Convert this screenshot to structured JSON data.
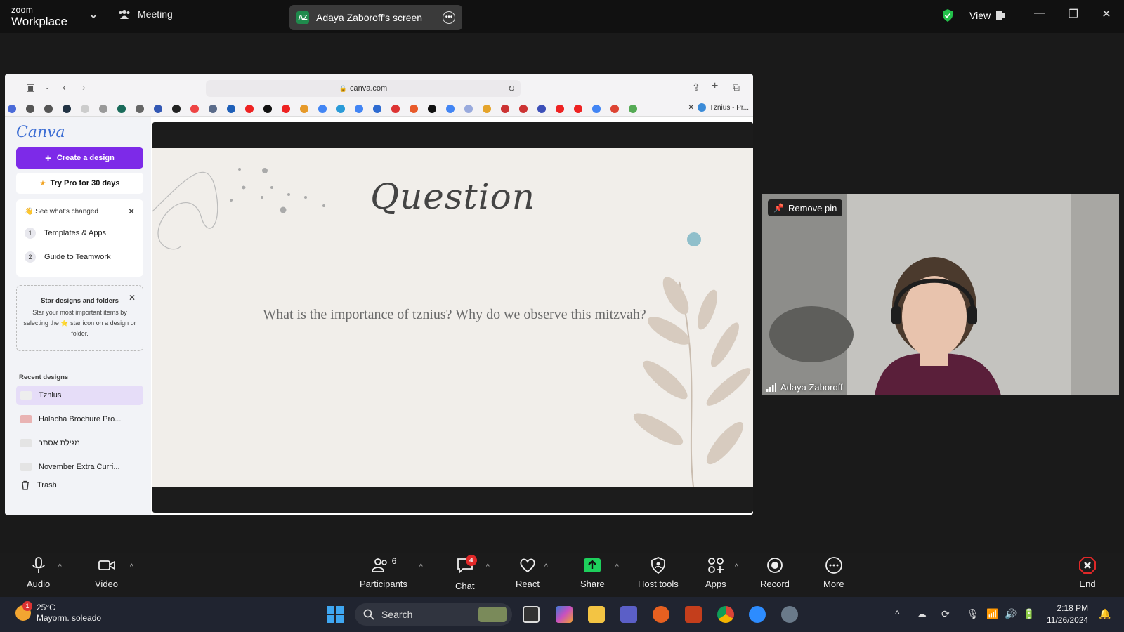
{
  "zoom": {
    "logo_line1": "zoom",
    "logo_line2": "Workplace",
    "meeting_label": "Meeting",
    "screen_initials": "AZ",
    "screen_label": "Adaya Zaboroff's screen",
    "view_label": "View"
  },
  "browser": {
    "url": "canva.com",
    "active_tab": "Tznius - Pr..."
  },
  "canva": {
    "logo": "Canva",
    "create_label": "Create a design",
    "try_pro_label": "Try Pro for 30 days",
    "whats_changed": {
      "heading": "See what's changed",
      "items": [
        {
          "num": "1",
          "label": "Templates & Apps"
        },
        {
          "num": "2",
          "label": "Guide to Teamwork"
        }
      ]
    },
    "star_card": {
      "heading": "Star designs and folders",
      "body": "Star your most important items by selecting the ⭐ star icon on a design or folder."
    },
    "recent_label": "Recent designs",
    "recent": [
      {
        "label": "Tznius"
      },
      {
        "label": "Halacha Brochure Pro..."
      },
      {
        "label": "מגילת אסתר"
      },
      {
        "label": "November Extra Curri..."
      }
    ],
    "trash_label": "Trash"
  },
  "slide": {
    "title": "Question",
    "text": "What is the importance of tznius? Why do we observe this mitzvah?"
  },
  "camera": {
    "pin_label": "Remove pin",
    "participant_name": "Adaya Zaboroff"
  },
  "controls": {
    "audio": "Audio",
    "video": "Video",
    "participants": "Participants",
    "participants_count": "6",
    "chat": "Chat",
    "chat_badge": "4",
    "react": "React",
    "share": "Share",
    "host_tools": "Host tools",
    "apps": "Apps",
    "record": "Record",
    "more": "More",
    "end": "End"
  },
  "taskbar": {
    "weather_temp": "25°C",
    "weather_desc": "Mayorm. soleado",
    "weather_badge": "1",
    "search_label": "Search",
    "time": "2:18 PM",
    "date": "11/26/2024"
  },
  "colors": {
    "canva_purple": "#7d2ae8",
    "zoom_share_green": "#1ecf5c",
    "end_red": "#e02828"
  }
}
